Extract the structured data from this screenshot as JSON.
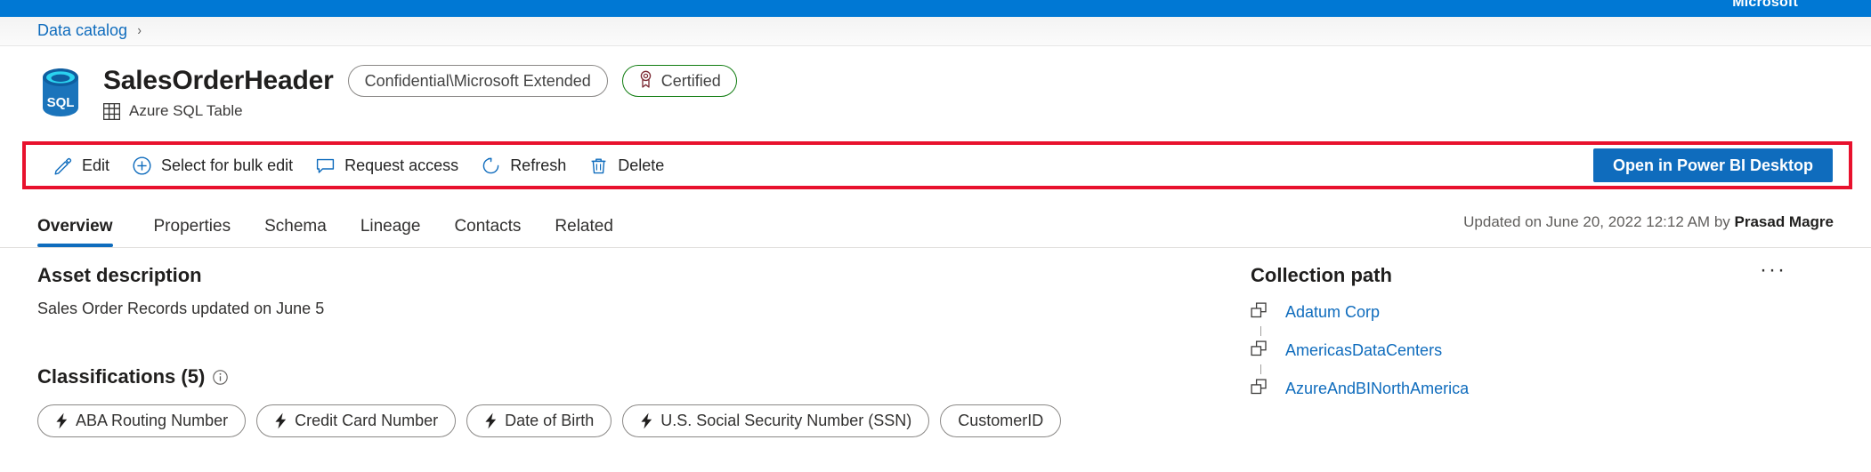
{
  "top_bar": {
    "brand": "Microsoft",
    "color": "#0078d4"
  },
  "breadcrumb": {
    "items": [
      "Data catalog"
    ],
    "separator": "›"
  },
  "asset": {
    "icon_name": "azure-sql-database-icon",
    "icon_label": "SQL",
    "title": "SalesOrderHeader",
    "sensitivity_label": "Confidential\\Microsoft Extended",
    "certified_label": "Certified",
    "certified_color": "#107c10",
    "type_label": "Azure SQL Table"
  },
  "command_bar": {
    "highlight_color": "#e8112d",
    "actions": [
      {
        "label": "Edit",
        "icon": "pencil-icon"
      },
      {
        "label": "Select for bulk edit",
        "icon": "plus-circle-icon"
      },
      {
        "label": "Request access",
        "icon": "comment-icon"
      },
      {
        "label": "Refresh",
        "icon": "refresh-icon"
      },
      {
        "label": "Delete",
        "icon": "trash-icon"
      }
    ],
    "primary_action": {
      "label": "Open in Power BI Desktop",
      "color": "#0f6cbd"
    }
  },
  "tabs": {
    "active": "Overview",
    "items": [
      {
        "label": "Overview"
      },
      {
        "label": "Properties"
      },
      {
        "label": "Schema"
      },
      {
        "label": "Lineage"
      },
      {
        "label": "Contacts"
      },
      {
        "label": "Related"
      }
    ],
    "accent_color": "#0f6cbd"
  },
  "updated": {
    "prefix": "Updated on June 20, 2022 12:12 AM by ",
    "user": "Prasad Magre"
  },
  "asset_description": {
    "heading": "Asset description",
    "text": "Sales Order Records updated on June 5"
  },
  "classifications": {
    "heading": "Classifications (5)",
    "info_icon": "info-icon",
    "items": [
      {
        "label": "ABA Routing Number",
        "icon": "bolt-icon"
      },
      {
        "label": "Credit Card Number",
        "icon": "bolt-icon"
      },
      {
        "label": "Date of Birth",
        "icon": "bolt-icon"
      },
      {
        "label": "U.S. Social Security Number (SSN)",
        "icon": "bolt-icon"
      },
      {
        "label": "CustomerID",
        "icon": "none"
      }
    ]
  },
  "collection_path": {
    "heading": "Collection path",
    "more_label": "···",
    "items": [
      {
        "label": "Adatum Corp",
        "icon": "collection-icon"
      },
      {
        "label": "AmericasDataCenters",
        "icon": "collection-icon"
      },
      {
        "label": "AzureAndBINorthAmerica",
        "icon": "collection-icon"
      }
    ],
    "link_color": "#0f6cbd"
  }
}
